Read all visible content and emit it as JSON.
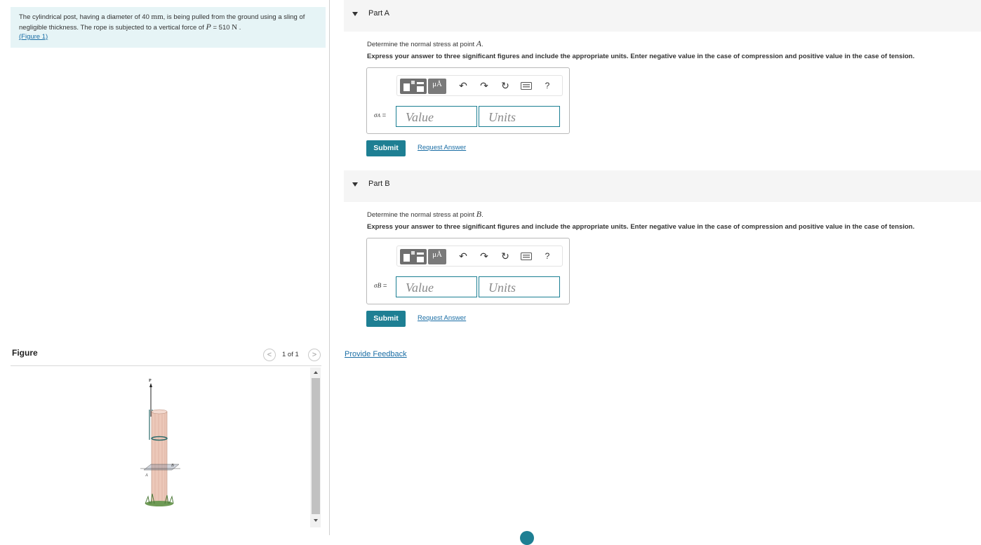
{
  "problem": {
    "text_part1": "The cylindrical post, having a diameter of 40 ",
    "unit_mm": "mm",
    "text_part2": ", is being pulled from the ground using a sling of negligible thickness. The rope is subjected to a vertical force of ",
    "var_P": "P",
    "text_eq": " = 510 ",
    "unit_N": "N",
    "text_end": " .",
    "figure_link": "(Figure 1)"
  },
  "parts": [
    {
      "label": "Part A",
      "question_prefix": "Determine the normal stress at point ",
      "point": "A",
      "question_suffix": ".",
      "instructions": "Express your answer to three significant figures and include the appropriate units. Enter negative value in the case of compression and positive value in the case of tension.",
      "sigma_symbol": "σ",
      "sigma_sub": "A",
      "sigma_eq": " =",
      "value_placeholder": "Value",
      "units_placeholder": "Units",
      "submit_label": "Submit",
      "request_label": "Request Answer"
    },
    {
      "label": "Part B",
      "question_prefix": "Determine the normal stress at point ",
      "point": "B",
      "question_suffix": ".",
      "instructions": "Express your answer to three significant figures and include the appropriate units. Enter negative value in the case of compression and positive value in the case of tension.",
      "sigma_symbol": "σ",
      "sigma_sub": "B",
      "sigma_eq": " =",
      "value_placeholder": "Value",
      "units_placeholder": "Units",
      "submit_label": "Submit",
      "request_label": "Request Answer"
    }
  ],
  "toolbar": {
    "templates_icon": "templates-icon",
    "units_label": "μÅ",
    "undo_icon": "↶",
    "redo_icon": "↷",
    "reset_icon": "↻",
    "keyboard_icon": "keyboard-icon",
    "help_label": "?"
  },
  "figure": {
    "title": "Figure",
    "counter": "1 of 1",
    "prev_icon": "<",
    "next_icon": ">",
    "label_P": "P",
    "label_A": "A",
    "label_B": "B"
  },
  "feedback_label": "Provide Feedback",
  "colors": {
    "accent": "#1e7f93",
    "link": "#1b6ea5",
    "problem_bg": "#e6f4f6",
    "part_bar_bg": "#f5f5f5"
  }
}
